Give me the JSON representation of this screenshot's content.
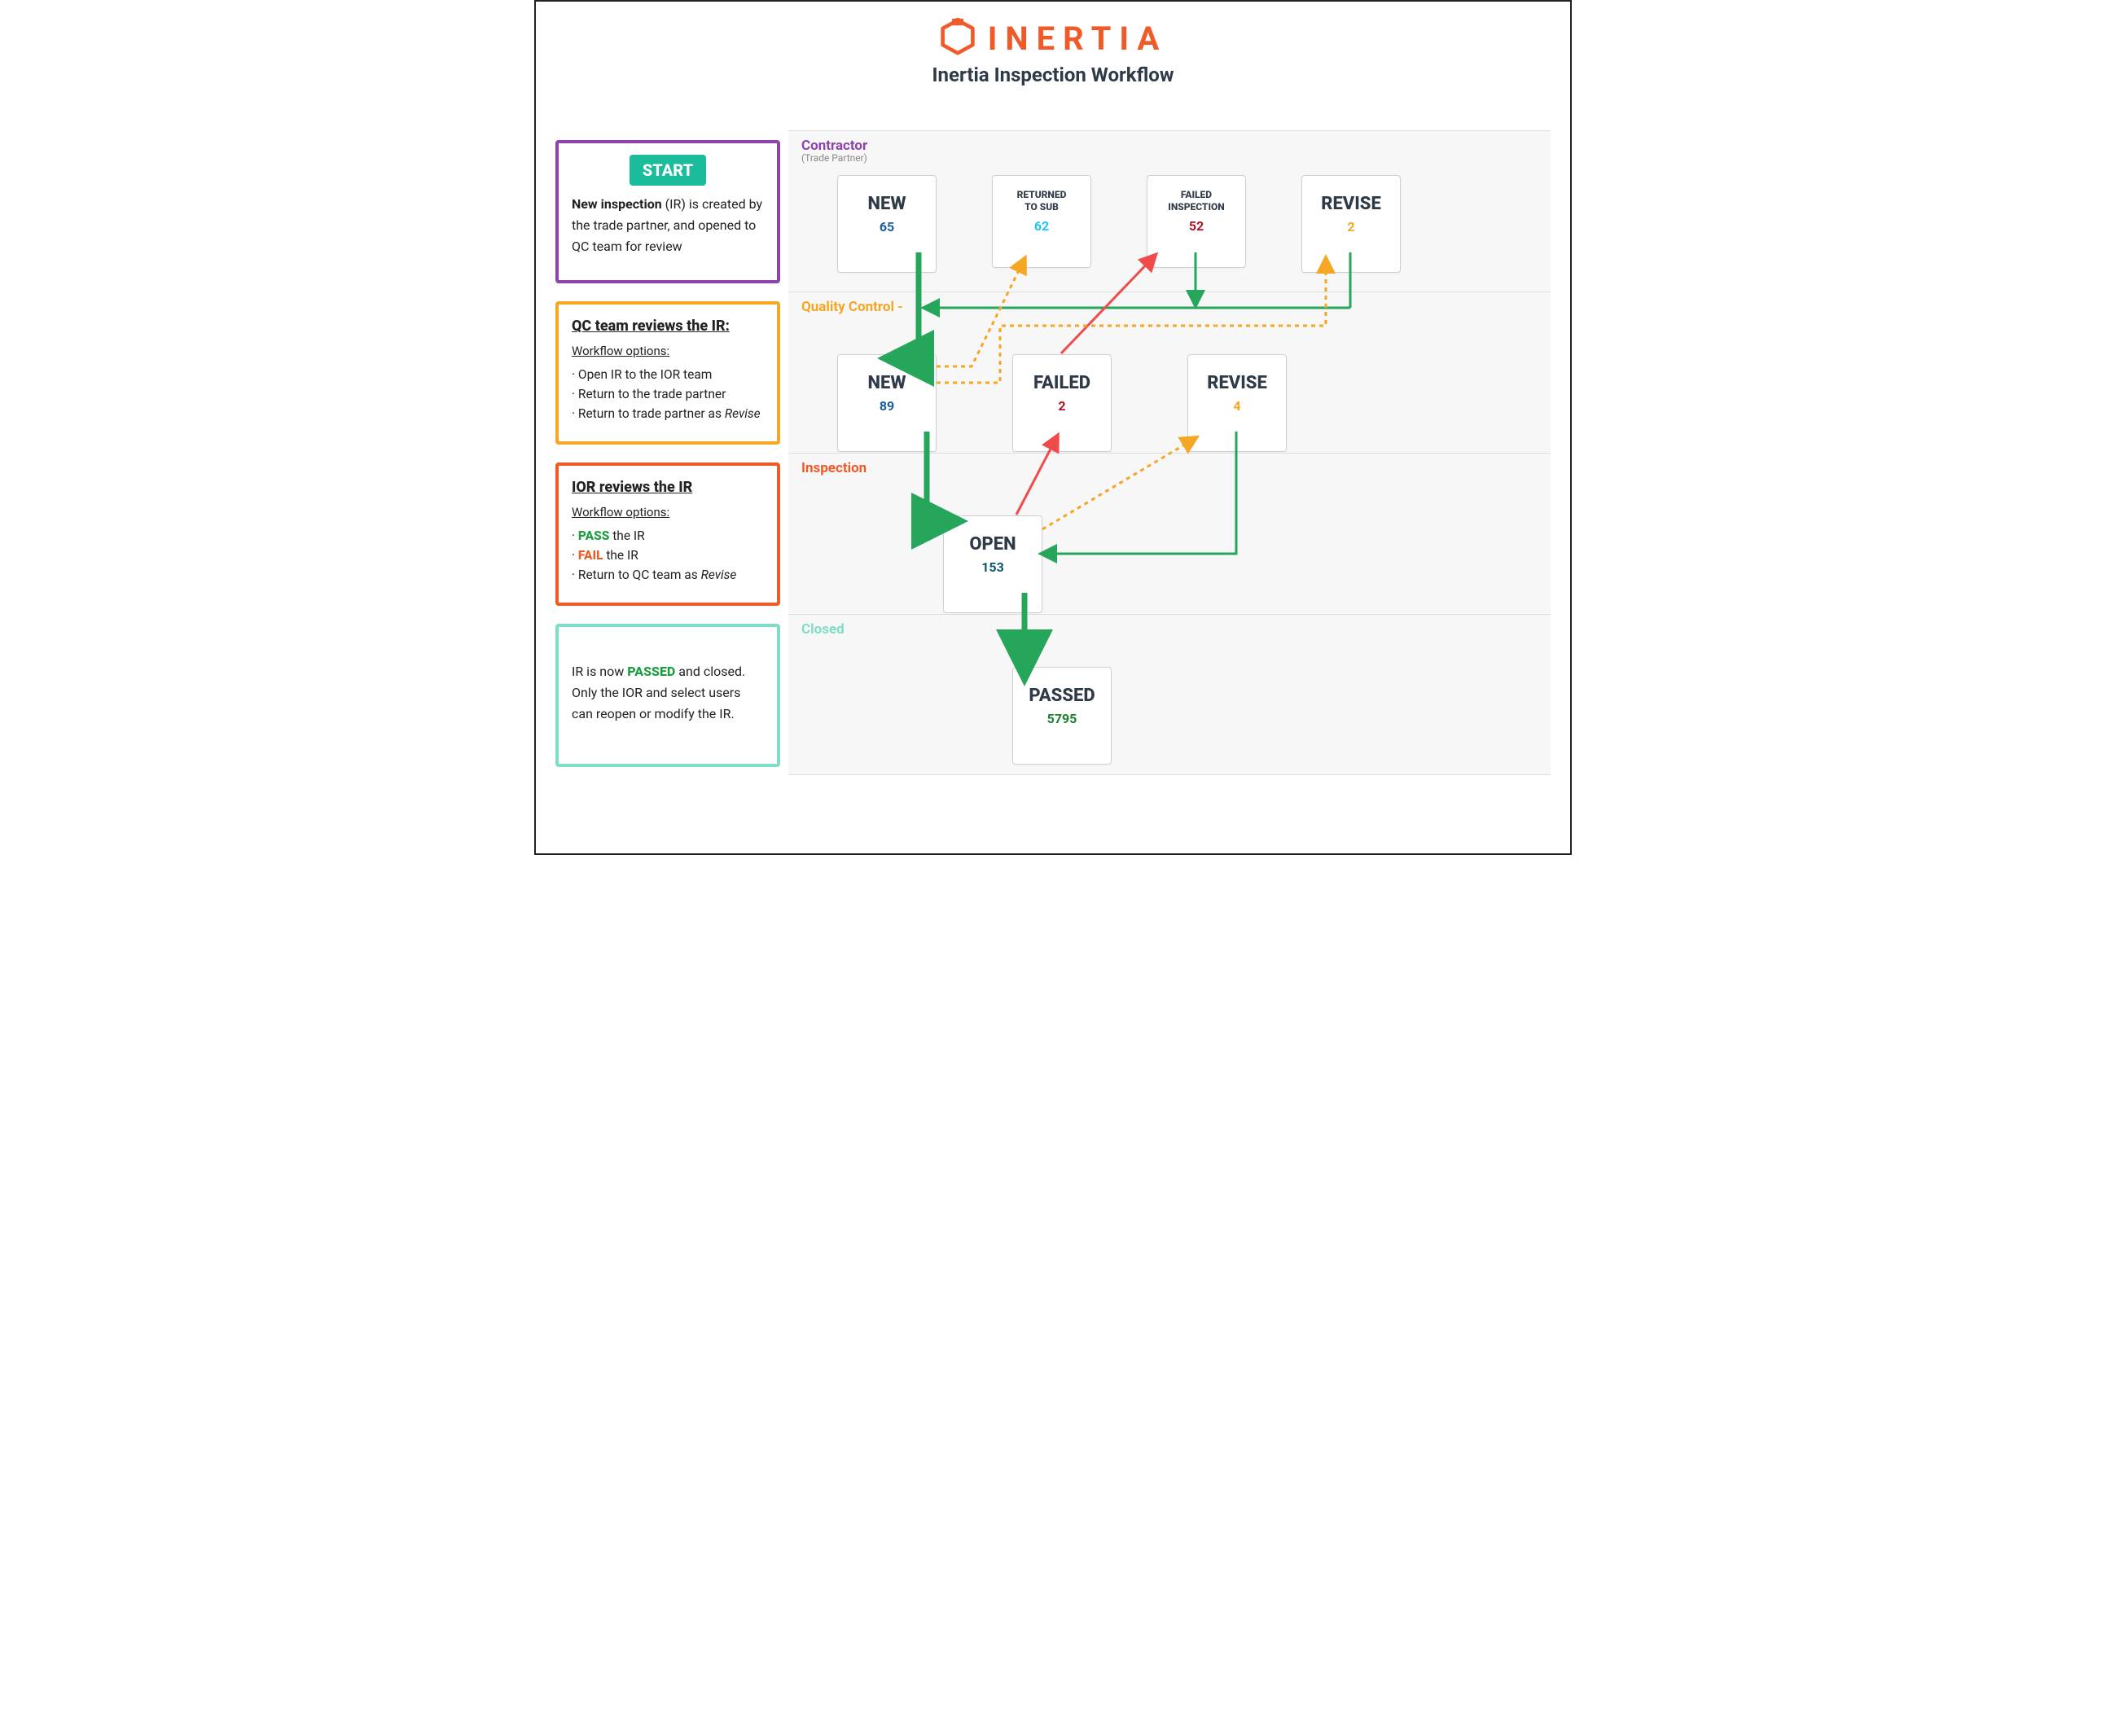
{
  "brand": "INERTIA",
  "title": "Inertia Inspection Workflow",
  "lanes": {
    "contractor": {
      "title": "Contractor",
      "sub": "(Trade Partner)"
    },
    "qc": {
      "title": "Quality Control -"
    },
    "insp": {
      "title": "Inspection"
    },
    "closed": {
      "title": "Closed"
    }
  },
  "cards": {
    "c_new": {
      "label": "NEW",
      "count": "65",
      "count_color": "#1b5fa3"
    },
    "c_ret": {
      "label1": "RETURNED",
      "label2": "TO SUB",
      "count": "62",
      "count_color": "#20c5f0"
    },
    "c_fail": {
      "label1": "FAILED",
      "label2": "INSPECTION",
      "count": "52",
      "count_color": "#b11226"
    },
    "c_rev": {
      "label": "REVISE",
      "count": "2",
      "count_color": "#f5a623"
    },
    "q_new": {
      "label": "NEW",
      "count": "89",
      "count_color": "#1b5fa3"
    },
    "q_fail": {
      "label": "FAILED",
      "count": "2",
      "count_color": "#b11226"
    },
    "q_rev": {
      "label": "REVISE",
      "count": "4",
      "count_color": "#f5a623"
    },
    "i_open": {
      "label": "OPEN",
      "count": "153",
      "count_color": "#0e556b"
    },
    "closed": {
      "label": "PASSED",
      "count": "5795",
      "count_color": "#1b7f2f"
    }
  },
  "desc": {
    "start": {
      "badge": "START",
      "line1a": "New inspection",
      "line1b": " (IR) is created by the trade partner, and opened to QC team for review"
    },
    "qc": {
      "heading": "QC team reviews the IR:",
      "wfo": "Workflow options:",
      "items": [
        "Open IR to the IOR team",
        "Return to the trade partner",
        "Return to trade partner as "
      ],
      "revise": "Revise"
    },
    "ior": {
      "heading": "IOR reviews the IR",
      "wfo": "Workflow options:",
      "pass": "PASS",
      "pass_tail": " the IR",
      "fail": "FAIL",
      "fail_tail": " the IR",
      "ret": "Return to QC team as ",
      "revise": "Revise"
    },
    "closed": {
      "line1a": "IR is now ",
      "pass": "PASSED",
      "line1b": " and closed. Only the IOR and select users can reopen or modify the IR."
    }
  },
  "colors": {
    "green": "#26a65b",
    "yellow": "#f5a623",
    "red": "#ef4b4b"
  }
}
